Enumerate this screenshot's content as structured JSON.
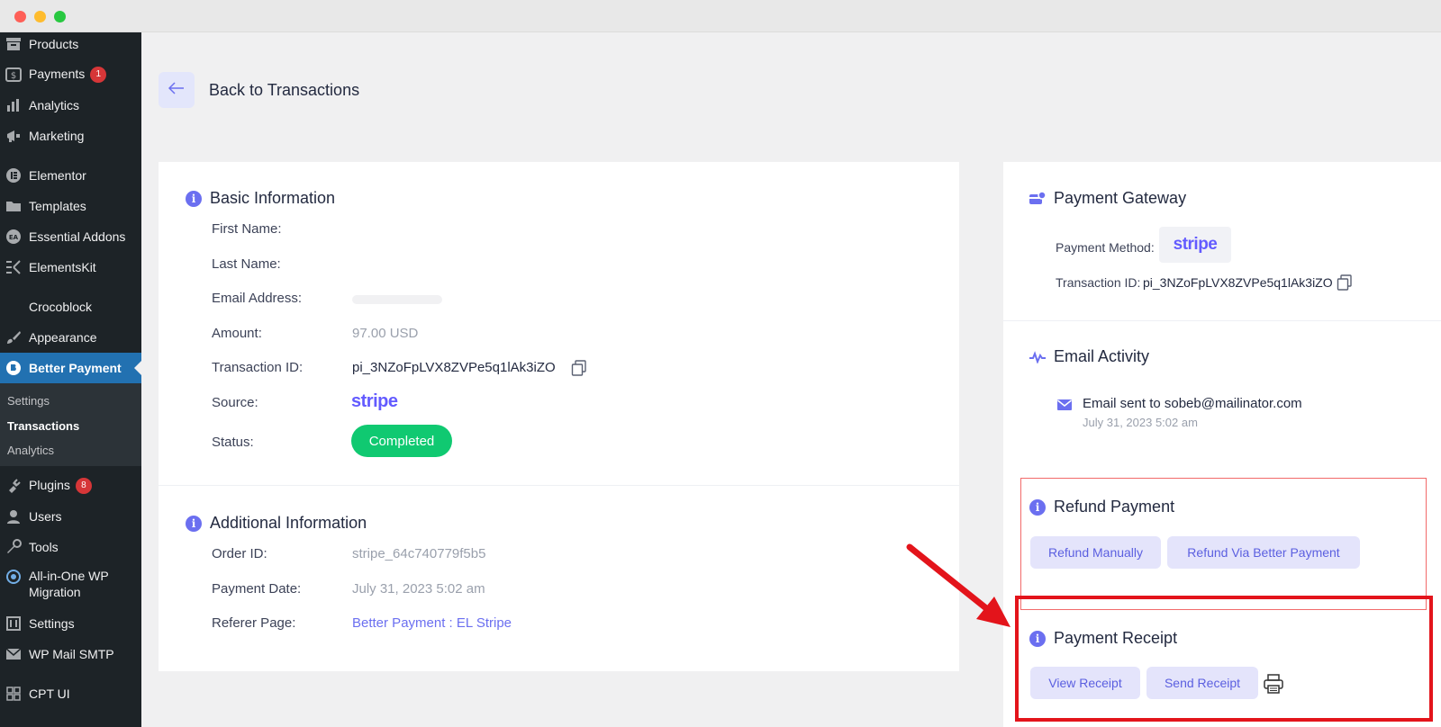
{
  "sidebar": {
    "items": [
      {
        "label": "Products",
        "icon": "archive-icon"
      },
      {
        "label": "Payments",
        "icon": "dollar-icon",
        "badge": "1"
      },
      {
        "label": "Analytics",
        "icon": "bar-chart-icon"
      },
      {
        "label": "Marketing",
        "icon": "megaphone-icon"
      },
      {
        "label": "Elementor",
        "icon": "elementor-icon"
      },
      {
        "label": "Templates",
        "icon": "folder-icon"
      },
      {
        "label": "Essential Addons",
        "icon": "ea-icon"
      },
      {
        "label": "ElementsKit",
        "icon": "ek-icon"
      },
      {
        "label": "Crocoblock",
        "icon": ""
      },
      {
        "label": "Appearance",
        "icon": "brush-icon"
      },
      {
        "label": "Better Payment",
        "icon": "better-payment-icon",
        "active": true
      },
      {
        "label": "Plugins",
        "icon": "plug-icon",
        "badge": "8"
      },
      {
        "label": "Users",
        "icon": "user-icon"
      },
      {
        "label": "Tools",
        "icon": "wrench-icon"
      },
      {
        "label": "All-in-One WP",
        "label2": "Migration",
        "icon": "migration-icon"
      },
      {
        "label": "Settings",
        "icon": "sliders-icon"
      },
      {
        "label": "WP Mail SMTP",
        "icon": "mail-smtp-icon"
      },
      {
        "label": "CPT UI",
        "icon": "grid-icon"
      }
    ],
    "submenu": [
      "Settings",
      "Transactions",
      "Analytics"
    ]
  },
  "header": {
    "back_label": "Back to Transactions"
  },
  "basic_info": {
    "title": "Basic Information",
    "fields": [
      {
        "label": "First Name:",
        "value": ""
      },
      {
        "label": "Last Name:",
        "value": ""
      },
      {
        "label": "Email Address:",
        "value": ""
      },
      {
        "label": "Amount:",
        "value": "97.00 USD"
      },
      {
        "label": "Transaction ID:",
        "value": "pi_3NZoFpLVX8ZVPe5q1lAk3iZO"
      },
      {
        "label": "Source:",
        "value": "stripe"
      },
      {
        "label": "Status:",
        "value": "Completed"
      }
    ]
  },
  "additional_info": {
    "title": "Additional Information",
    "fields": [
      {
        "label": "Order ID:",
        "value": "stripe_64c740779f5b5"
      },
      {
        "label": "Payment Date:",
        "value": "July 31, 2023 5:02 am"
      },
      {
        "label": "Referer Page:",
        "value": "Better Payment : EL Stripe"
      }
    ]
  },
  "gateway": {
    "title": "Payment Gateway",
    "method_label": "Payment Method:",
    "method_value": "stripe",
    "txn_label": "Transaction ID:",
    "txn_value": "pi_3NZoFpLVX8ZVPe5q1lAk3iZO"
  },
  "email_activity": {
    "title": "Email Activity",
    "text": "Email sent to sobeb@mailinator.com",
    "time": "July 31, 2023 5:02 am"
  },
  "refund": {
    "title": "Refund Payment",
    "manual_label": "Refund Manually",
    "via_label": "Refund Via Better Payment"
  },
  "receipt": {
    "title": "Payment Receipt",
    "view_label": "View Receipt",
    "send_label": "Send Receipt"
  },
  "colors": {
    "accent": "#6b6ff0",
    "status_green": "#10c971",
    "sidebar_bg": "#1d2327",
    "active_blue": "#2271b1",
    "annotation_red": "#e3141b"
  }
}
